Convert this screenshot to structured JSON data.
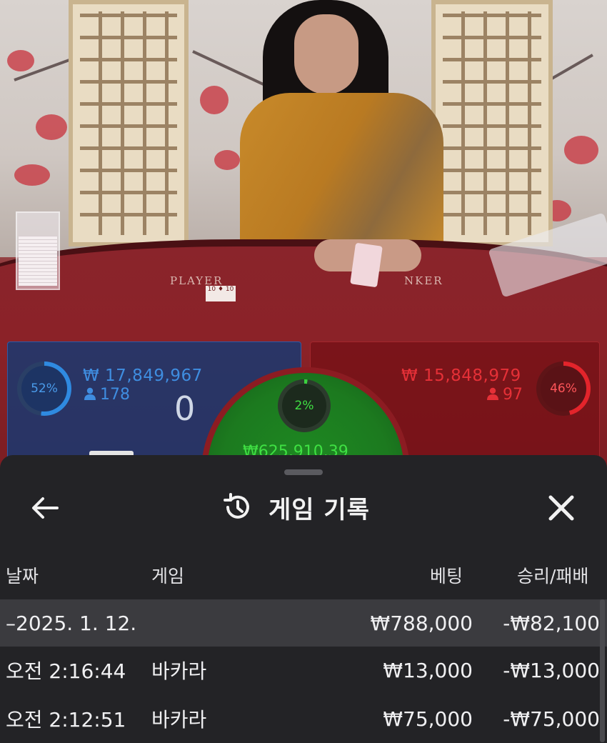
{
  "video": {
    "table_labels": {
      "player": "PLAYER",
      "banker": "NKER"
    },
    "table_card": "10 ♦ 10"
  },
  "bets": {
    "player": {
      "percent": "52%",
      "amount": "₩ 17,849,967",
      "bettors": "178",
      "score": "0",
      "fill": 0.52,
      "color": "#2f8ae0"
    },
    "banker": {
      "percent": "46%",
      "amount": "₩ 15,848,979",
      "bettors": "97",
      "fill": 0.46,
      "color": "#e3242b"
    },
    "tie": {
      "percent": "2%",
      "amount": "₩625,910.39",
      "fill": 0.02,
      "color": "#3bd13f"
    },
    "bettor_icon": "person-icon"
  },
  "sheet": {
    "title": "게임 기록",
    "title_icon": "history-icon",
    "back_icon": "arrow-left-icon",
    "close_icon": "close-icon",
    "columns": {
      "date": "날짜",
      "game": "게임",
      "bet": "베팅",
      "result": "승리/패배"
    },
    "summary": {
      "date": "–2025. 1. 12.",
      "bet": "₩788,000",
      "result": "-₩82,100"
    },
    "rows": [
      {
        "time": "오전 2:16:44",
        "game": "바카라",
        "bet": "₩13,000",
        "result": "-₩13,000"
      },
      {
        "time": "오전 2:12:51",
        "game": "바카라",
        "bet": "₩75,000",
        "result": "-₩75,000"
      }
    ]
  }
}
